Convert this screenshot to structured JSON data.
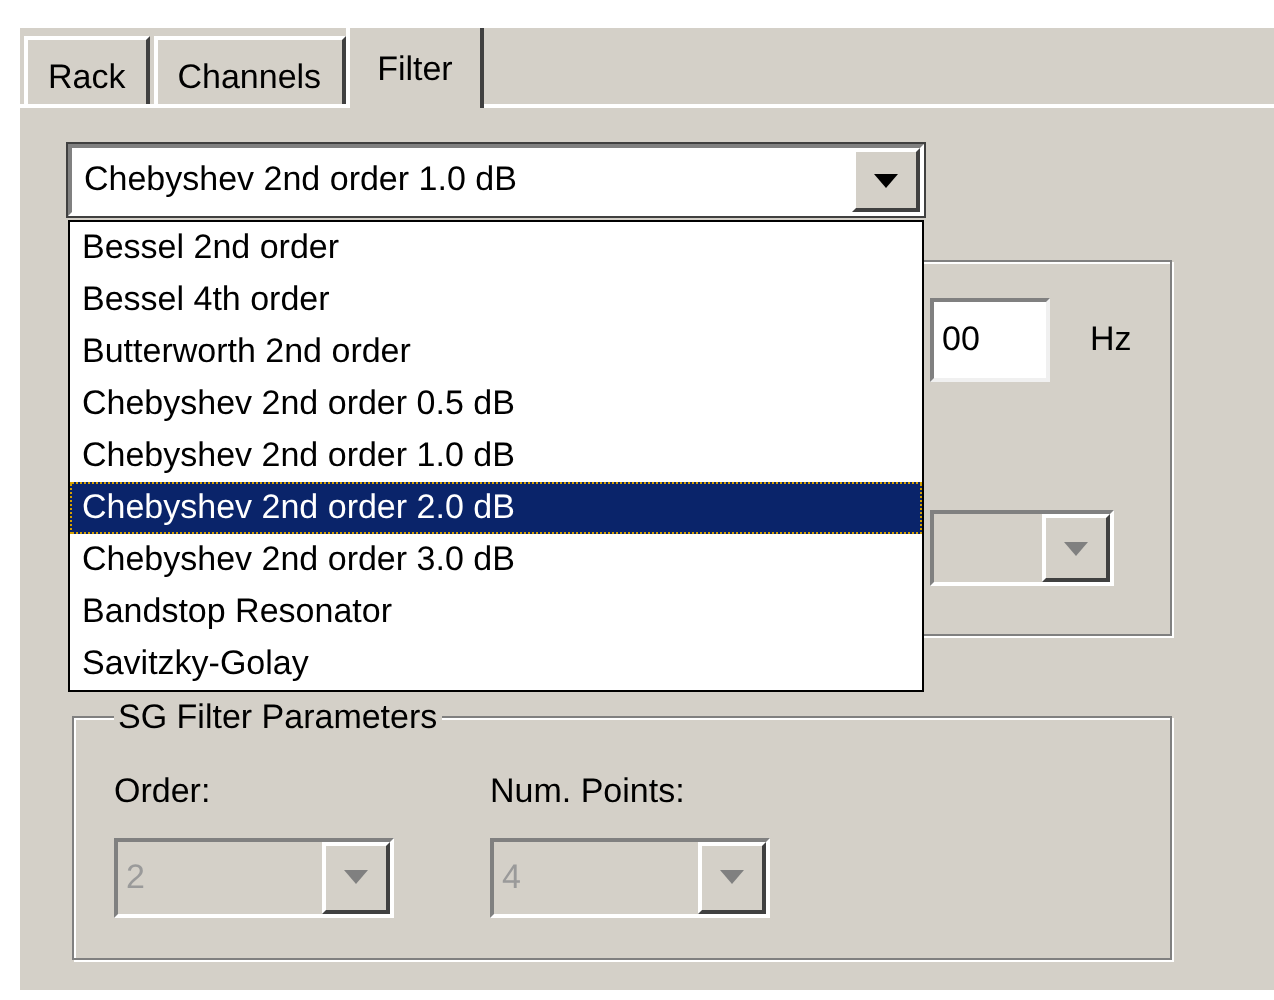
{
  "tabs": [
    {
      "label": "Rack",
      "selected": false
    },
    {
      "label": "Channels",
      "selected": false
    },
    {
      "label": "Filter",
      "selected": true
    }
  ],
  "filter_type": {
    "value": "Chebyshev 2nd order 1.0 dB",
    "expanded": true,
    "options": [
      {
        "label": "Bessel 2nd order",
        "highlighted": false
      },
      {
        "label": "Bessel 4th order",
        "highlighted": false
      },
      {
        "label": "Butterworth 2nd order",
        "highlighted": false
      },
      {
        "label": "Chebyshev 2nd order 0.5 dB",
        "highlighted": false
      },
      {
        "label": "Chebyshev 2nd order 1.0 dB",
        "highlighted": false
      },
      {
        "label": "Chebyshev 2nd order 2.0 dB",
        "highlighted": true
      },
      {
        "label": "Chebyshev 2nd order 3.0 dB",
        "highlighted": false
      },
      {
        "label": "Bandstop Resonator",
        "highlighted": false
      },
      {
        "label": "Savitzky-Golay",
        "highlighted": false
      }
    ]
  },
  "cutoff": {
    "value": "00",
    "unit": "Hz"
  },
  "second_select": {
    "disabled": true
  },
  "sg_group": {
    "title": "SG Filter Parameters",
    "order": {
      "label": "Order:",
      "value": "2",
      "disabled": true
    },
    "num_points": {
      "label": "Num. Points:",
      "value": "4",
      "disabled": true
    }
  }
}
